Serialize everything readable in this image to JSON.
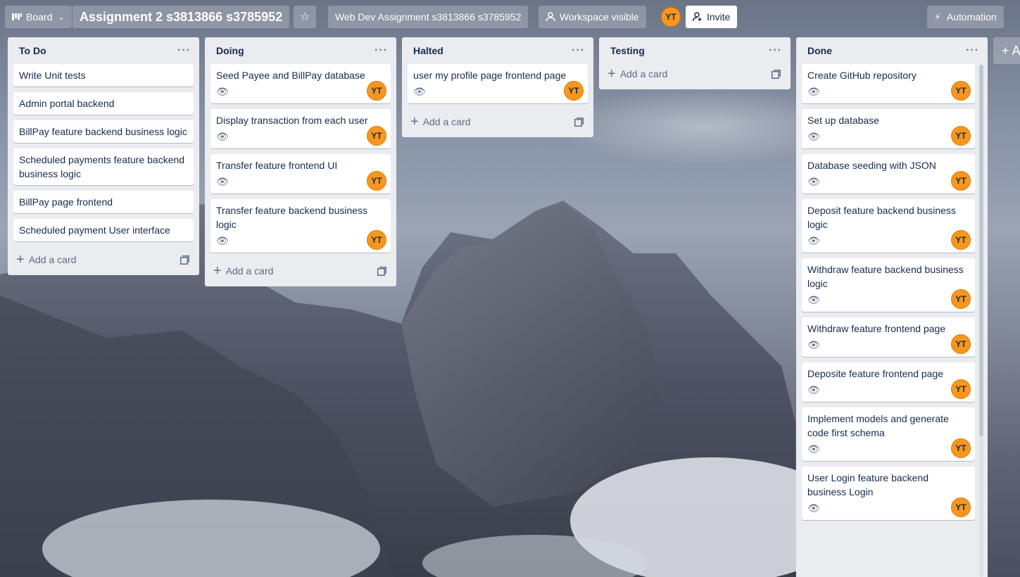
{
  "topbar": {
    "view_label": "Board",
    "board_title": "Assignment 2 s3813866 s3785952",
    "workspace_name": "Web Dev Assignment s3813866 s3785952",
    "visibility_label": "Workspace visible",
    "member_initials": "YT",
    "invite_label": "Invite",
    "automation_label": "Automation"
  },
  "lists": [
    {
      "title": "To Do",
      "cards": [
        {
          "title": "Write Unit tests"
        },
        {
          "title": "Admin portal backend"
        },
        {
          "title": "BillPay feature backend business logic"
        },
        {
          "title": "Scheduled payments feature backend business logic"
        },
        {
          "title": "BillPay page frontend"
        },
        {
          "title": "Scheduled payment User interface"
        }
      ],
      "add_card_label": "Add a card"
    },
    {
      "title": "Doing",
      "cards": [
        {
          "title": "Seed Payee and BillPay database",
          "member": "YT"
        },
        {
          "title": "Display transaction from each user",
          "member": "YT"
        },
        {
          "title": "Transfer feature frontend UI",
          "member": "YT"
        },
        {
          "title": "Transfer feature backend business logic",
          "member": "YT"
        }
      ],
      "add_card_label": "Add a card"
    },
    {
      "title": "Halted",
      "cards": [
        {
          "title": "user my profile page frontend page",
          "member": "YT"
        }
      ],
      "add_card_label": "Add a card"
    },
    {
      "title": "Testing",
      "cards": [],
      "add_card_label": "Add a card"
    },
    {
      "title": "Done",
      "cards": [
        {
          "title": "Create GitHub repository",
          "member": "YT"
        },
        {
          "title": "Set up database",
          "member": "YT"
        },
        {
          "title": "Database seeding with JSON",
          "member": "YT"
        },
        {
          "title": "Deposit feature backend business logic",
          "member": "YT"
        },
        {
          "title": "Withdraw feature backend business logic",
          "member": "YT"
        },
        {
          "title": "Withdraw feature frontend page",
          "member": "YT"
        },
        {
          "title": "Deposite feature frontend page",
          "member": "YT"
        },
        {
          "title": "Implement models and generate code first schema",
          "member": "YT"
        },
        {
          "title": "User Login feature backend business Login",
          "member": "YT"
        }
      ]
    }
  ],
  "add_list_label": "+ A",
  "colors": {
    "list_bg": "#ebecf0",
    "avatar": "#f8961e",
    "text": "#172b4d"
  }
}
